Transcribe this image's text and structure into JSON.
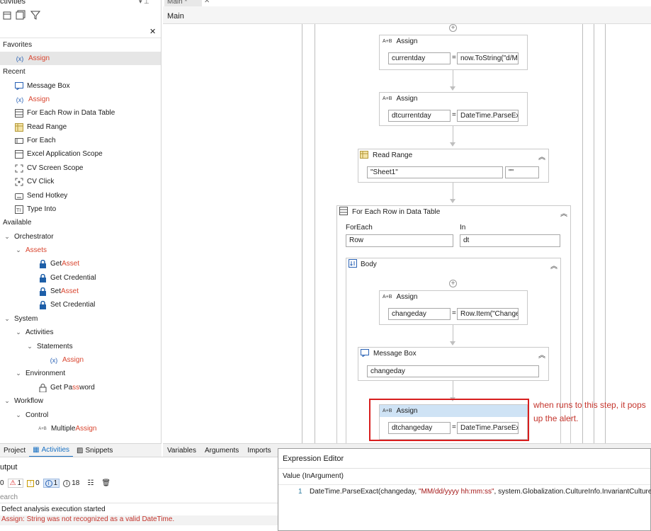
{
  "activities_panel": {
    "title": "ctivities",
    "pin": "▾  ⊥",
    "toolbar_icons": [
      "expand-icon",
      "collapse-icon",
      "filter-icon"
    ],
    "close_glyph": "✕",
    "favorites_label": "Favorites",
    "favorites": [
      {
        "icon": "(x)",
        "label": "Assign",
        "highlight": "Assign"
      }
    ],
    "recent_label": "Recent",
    "recent": [
      {
        "icon": "msg-icon",
        "label": "Message Box"
      },
      {
        "icon": "(x)",
        "label": "Assign"
      },
      {
        "icon": "foreach-row-icon",
        "label": "For Each Row in Data Table"
      },
      {
        "icon": "excel-icon",
        "label": "Read Range"
      },
      {
        "icon": "foreach-icon",
        "label": "For Each"
      },
      {
        "icon": "excel-scope-icon",
        "label": "Excel Application Scope"
      },
      {
        "icon": "cv-scope-icon",
        "label": "CV Screen Scope"
      },
      {
        "icon": "cv-click-icon",
        "label": "CV Click"
      },
      {
        "icon": "hotkey-icon",
        "label": "Send Hotkey"
      },
      {
        "icon": "typeinto-icon",
        "label": "Type Into"
      }
    ],
    "available_label": "Available",
    "orchestrator": "Orchestrator",
    "assets": "Assets",
    "asset_items": [
      {
        "pre": "Get ",
        "hl": "Asset",
        "post": ""
      },
      {
        "pre": "Get Credential",
        "hl": "",
        "post": ""
      },
      {
        "pre": "Set ",
        "hl": "Asset",
        "post": ""
      },
      {
        "pre": "Set Credential",
        "hl": "",
        "post": ""
      }
    ],
    "system": "System",
    "activities": "Activities",
    "statements": "Statements",
    "statements_assign": "Assign",
    "environment": "Environment",
    "get_password_pre": "Get Pa",
    "get_password_hl": "ss",
    "get_password_post": "word",
    "workflow": "Workflow",
    "control": "Control",
    "multiple_pre": "Multiple ",
    "multiple_hl": "Assign"
  },
  "left_tabs": {
    "project": "Project",
    "activities": "Activities",
    "snippets": "Snippets"
  },
  "doc_tab": "Main *",
  "breadcrumb": "Main",
  "workflow": {
    "assign1": {
      "title": "Assign",
      "to": "currentday",
      "value": "now.ToString(\"d/M"
    },
    "assign2": {
      "title": "Assign",
      "to": "dtcurrentday",
      "value": "DateTime.ParseExa"
    },
    "read_range": {
      "title": "Read Range",
      "sheet": "\"Sheet1\"",
      "range": "\"\""
    },
    "for_each_row": {
      "title": "For Each Row in Data Table",
      "foreach_label": "ForEach",
      "in_label": "In",
      "item": "Row",
      "table": "dt"
    },
    "body": {
      "title": "Body"
    },
    "assign3": {
      "title": "Assign",
      "to": "changeday",
      "value": "Row.Item(\"Change"
    },
    "message_box": {
      "title": "Message Box",
      "text": "changeday"
    },
    "assign4": {
      "title": "Assign",
      "to": "dtchangeday",
      "value": "DateTime.ParseExa"
    },
    "eq": "="
  },
  "annotation": "when runs to this step, it pops up the alert.",
  "designer_tabs": [
    "Variables",
    "Arguments",
    "Imports"
  ],
  "output": {
    "title": "utput",
    "counts": {
      "all": "0",
      "errors": "1",
      "warnings": "0",
      "info": "1",
      "trace": "18"
    },
    "search_placeholder": "earch",
    "lines": [
      {
        "text": "Defect analysis execution started",
        "level": "info"
      },
      {
        "text": "Assign: String was not recognized as a valid DateTime.",
        "level": "error"
      }
    ]
  },
  "expression_editor": {
    "title": "Expression Editor",
    "label": "Value (InArgument)",
    "line_number": "1",
    "code_pre": "DateTime.ParseExact(changeday, ",
    "code_str": "\"MM/dd/yyyy hh:mm:ss\"",
    "code_post": ", system.Globalization.CultureInfo.InvariantCulture)"
  },
  "colors": {
    "highlight_red": "#d81e1e",
    "accent_blue": "#1b72c4",
    "selected_activity": "#cfe3f5"
  }
}
